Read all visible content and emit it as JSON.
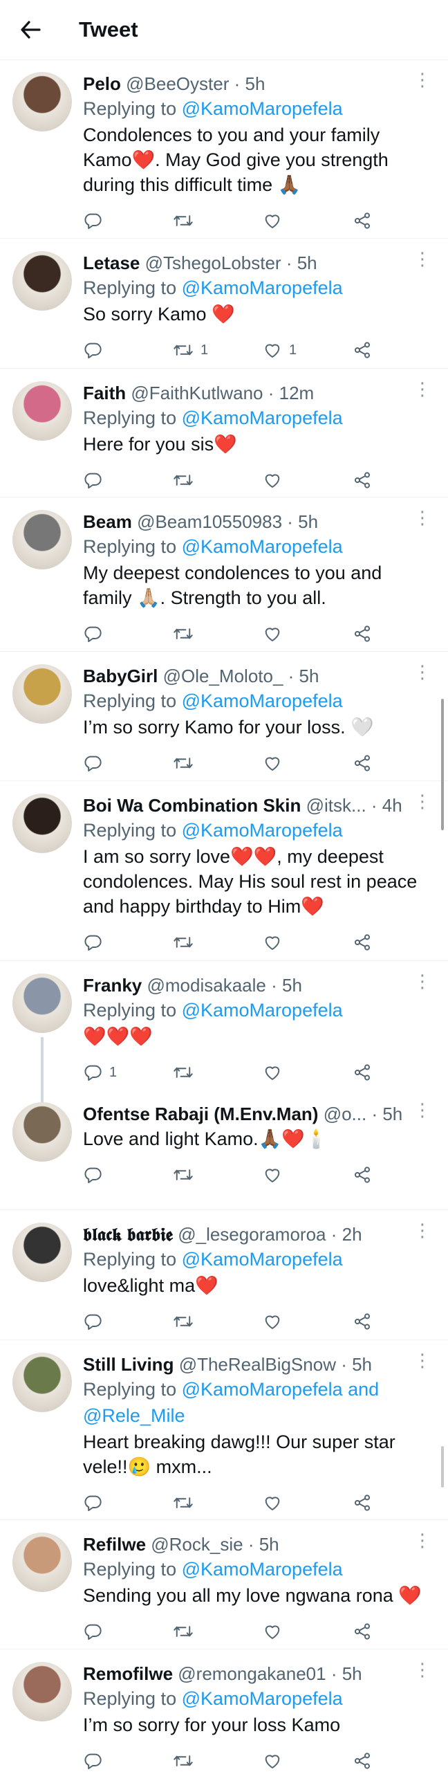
{
  "header": {
    "title": "Tweet"
  },
  "tweets": [
    {
      "name": "Pelo",
      "handle": "@BeeOyster",
      "time": "· 5h",
      "reply_prefix": "Replying to ",
      "reply_to": "@KamoMaropefela",
      "text": "Condolences to you and your family Kamo❤️. May God give you strength during this difficult time 🙏🏾",
      "reply_count": "",
      "retweet_count": "",
      "like_count": "",
      "avatar_color": "#6b4a3a"
    },
    {
      "name": "Letase",
      "handle": "@TshegoLobster",
      "time": "· 5h",
      "reply_prefix": "Replying to ",
      "reply_to": "@KamoMaropefela",
      "text": "So sorry Kamo ❤️",
      "reply_count": "",
      "retweet_count": "1",
      "like_count": "1",
      "avatar_color": "#3a2a22"
    },
    {
      "name": "Faith",
      "handle": "@FaithKutlwano",
      "time": "· 12m",
      "reply_prefix": "Replying to ",
      "reply_to": "@KamoMaropefela",
      "text": "Here for you sis❤️",
      "reply_count": "",
      "retweet_count": "",
      "like_count": "",
      "avatar_color": "#d46a8a"
    },
    {
      "name": "Beam",
      "handle": "@Beam10550983",
      "time": "· 5h",
      "reply_prefix": "Replying to ",
      "reply_to": "@KamoMaropefela",
      "text": "My deepest condolences to you and family 🙏🏼. Strength to you all.",
      "reply_count": "",
      "retweet_count": "",
      "like_count": "",
      "avatar_color": "#777777"
    },
    {
      "name": "BabyGirl",
      "handle": "@Ole_Moloto_",
      "time": "· 5h",
      "reply_prefix": "Replying to ",
      "reply_to": "@KamoMaropefela",
      "text": "I’m so sorry Kamo for your loss. 🤍",
      "reply_count": "",
      "retweet_count": "",
      "like_count": "",
      "avatar_color": "#c8a24a"
    },
    {
      "name": "Boi Wa Combination Skin",
      "handle": "@itsk...",
      "time": "· 4h",
      "reply_prefix": "Replying to ",
      "reply_to": "@KamoMaropefela",
      "text": "I am so sorry love❤️❤️, my deepest condolences. May His soul rest in peace and happy birthday to Him❤️",
      "reply_count": "",
      "retweet_count": "",
      "like_count": "",
      "avatar_color": "#2a1f1a"
    },
    {
      "name": "Franky",
      "handle": "@modisakaale",
      "time": "· 5h",
      "reply_prefix": "Replying to ",
      "reply_to": "@KamoMaropefela",
      "text": "❤️❤️❤️",
      "reply_count": "1",
      "retweet_count": "",
      "like_count": "",
      "avatar_color": "#8a96a8"
    },
    {
      "name": "Ofentse Rabaji (M.Env.Man)",
      "handle": "@o...",
      "time": "· 5h",
      "reply_prefix": "",
      "reply_to": "",
      "text": "Love and light Kamo.🙏🏾❤️🕯️",
      "reply_count": "",
      "retweet_count": "",
      "like_count": "",
      "avatar_color": "#7a6a55"
    },
    {
      "name": "𝖇𝖑𝖆𝖈𝖐 𝖇𝖆𝖗𝖇𝖎𝖊",
      "handle": "@_lesegoramoroa",
      "time": "· 2h",
      "reply_prefix": "Replying to ",
      "reply_to": "@KamoMaropefela",
      "text": "love&light ma❤️",
      "reply_count": "",
      "retweet_count": "",
      "like_count": "",
      "avatar_color": "#333333"
    },
    {
      "name": "Still Living",
      "handle": "@TheRealBigSnow",
      "time": "· 5h",
      "reply_prefix": "Replying to ",
      "reply_to": "@KamoMaropefela and @Rele_Mile",
      "text": "Heart breaking dawg!!! Our super star vele!!🥲 mxm...",
      "reply_count": "",
      "retweet_count": "",
      "like_count": "",
      "avatar_color": "#6a7a4a"
    },
    {
      "name": "Refilwe",
      "handle": "@Rock_sie",
      "time": "· 5h",
      "reply_prefix": "Replying to ",
      "reply_to": "@KamoMaropefela",
      "text": "Sending you all my love ngwana rona ❤️",
      "reply_count": "",
      "retweet_count": "",
      "like_count": "",
      "avatar_color": "#c99a7a"
    },
    {
      "name": "Remofilwe",
      "handle": "@remongakane01",
      "time": "· 5h",
      "reply_prefix": "Replying to ",
      "reply_to": "@KamoMaropefela",
      "text": "I’m so sorry for your loss Kamo",
      "reply_count": "",
      "retweet_count": "",
      "like_count": "",
      "avatar_color": "#9a6a5a"
    }
  ]
}
